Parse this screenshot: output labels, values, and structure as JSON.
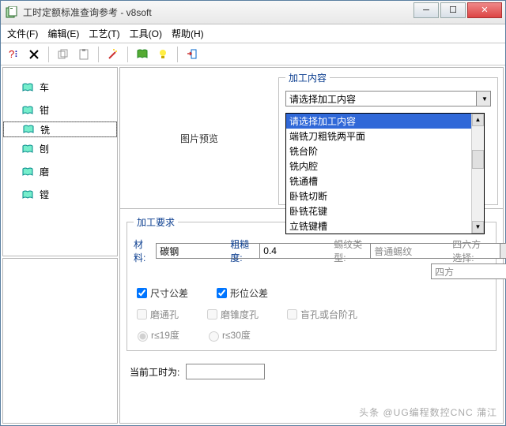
{
  "title": "工时定额标准查询参考 - v8soft",
  "menu": {
    "file": "文件(F)",
    "edit": "编辑(E)",
    "craft": "工艺(T)",
    "tool": "工具(O)",
    "help": "帮助(H)"
  },
  "tree": {
    "items": [
      "车",
      "钳",
      "铣",
      "刨",
      "磨",
      "镗"
    ],
    "selected": 2
  },
  "preview": "图片预览",
  "content": {
    "legend": "加工内容",
    "selected": "请选择加工内容",
    "options": [
      "请选择加工内容",
      "端铣刀粗铣两平面",
      "铣台阶",
      "铣内腔",
      "铣通槽",
      "卧铣切断",
      "卧铣花键",
      "立铣键槽"
    ]
  },
  "req": {
    "legend": "加工要求",
    "material_lbl": "材料:",
    "material": "碳钢",
    "rough_lbl": "粗糙度:",
    "rough": "0.4",
    "thread_lbl": "蜴纹类型:",
    "thread": "普通蜴纹",
    "square_lbl": "四六方选择:",
    "square": "四方",
    "dim_tol": "尺寸公差",
    "pos_tol": "形位公差",
    "mo1": "磨通孔",
    "mo2": "磨锥度孔",
    "mo3": "盲孔或台阶孔",
    "r1": "r≤19度",
    "r2": "r≤30度"
  },
  "bottom": {
    "cur": "当前工时为:"
  },
  "watermark": "头条 @UG编程数控CNC 蒲江"
}
